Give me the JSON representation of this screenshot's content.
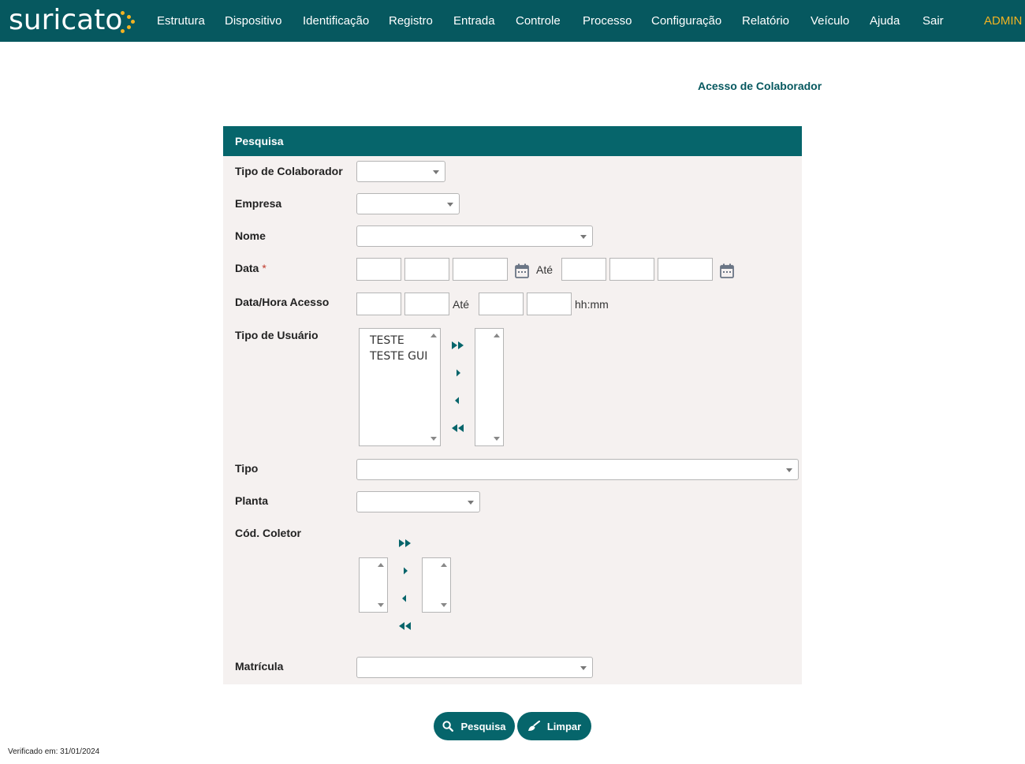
{
  "brand": {
    "logo_text": "suricato"
  },
  "nav": {
    "items": [
      "Estrutura",
      "Dispositivo",
      "Identificação",
      "Registro",
      "Entrada",
      "Controle",
      "Processo",
      "Configuração",
      "Relatório",
      "Veículo",
      "Ajuda",
      "Sair"
    ],
    "user": "ADMIN"
  },
  "page": {
    "title": "Acesso de Colaborador"
  },
  "form": {
    "header": "Pesquisa",
    "labels": {
      "tipo_colaborador": "Tipo de Colaborador",
      "empresa": "Empresa",
      "nome": "Nome",
      "data": "Data",
      "data_hora_acesso": "Data/Hora Acesso",
      "tipo_usuario": "Tipo de Usuário",
      "tipo": "Tipo",
      "planta": "Planta",
      "cod_coletor": "Cód. Coletor",
      "matricula": "Matrícula"
    },
    "required_mark": "*",
    "ate": "Até",
    "time_hint": "hh:mm",
    "tipo_usuario_options": [
      "TESTE",
      "TESTE GUI"
    ]
  },
  "buttons": {
    "search": "Pesquisa",
    "clear": "Limpar"
  },
  "footer": {
    "verified": "Verificado em: 31/01/2024"
  },
  "colors": {
    "primary": "#06585f",
    "accent": "#f2b322",
    "panel_bg": "#f5f1f0"
  }
}
